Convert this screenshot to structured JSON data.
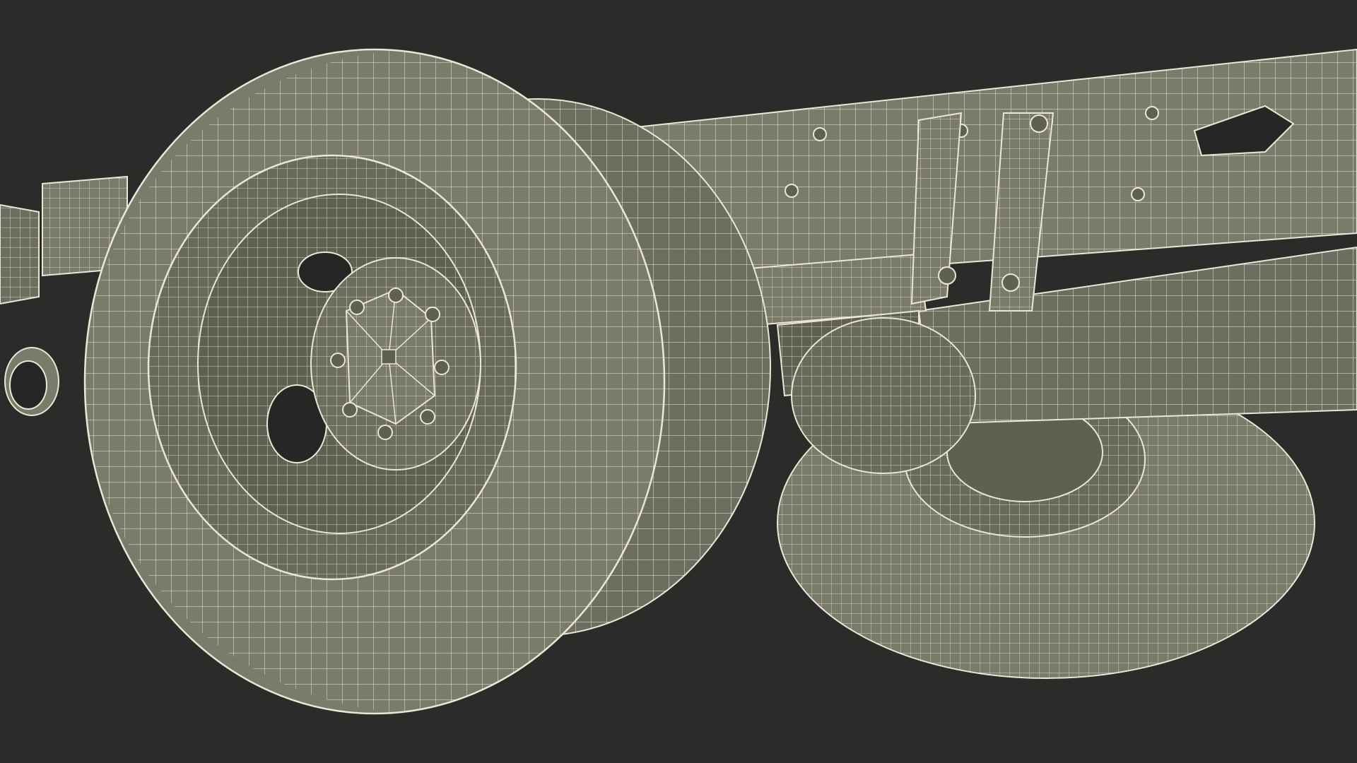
{
  "scene": {
    "subject": "truck-rear-axle-wireframe",
    "render_style": "wireframe-clay",
    "colors": {
      "background": "#2c2b29",
      "surface": "#7b7b6b",
      "surface_dark": "#5f5f52",
      "surface_shadow": "#4c4c42",
      "wire": "#e9e7d6",
      "cavity": "#262624"
    }
  }
}
